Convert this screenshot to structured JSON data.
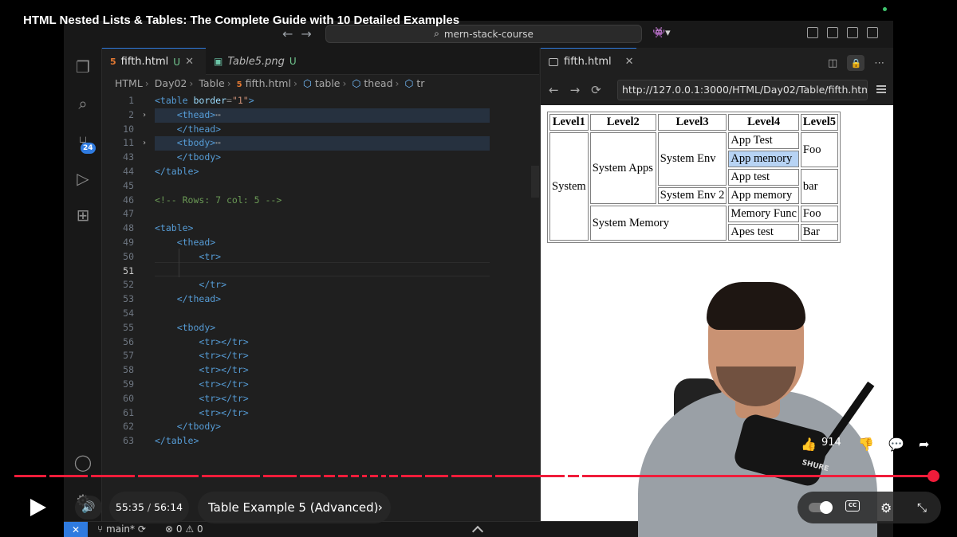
{
  "video": {
    "title": "HTML Nested Lists & Tables: The Complete Guide with 10 Detailed Examples",
    "time_current": "55:35",
    "time_total": "56:14",
    "chapter": "Table Example 5 (Advanced)",
    "likes": "914",
    "progress_fraction": 0.989
  },
  "vscode": {
    "command_center": "mern-stack-course",
    "scm_badge": "24",
    "tabs": [
      {
        "label": "fifth.html",
        "status": "U",
        "active": true
      },
      {
        "label": "Table5.png",
        "status": "U",
        "active": false
      }
    ],
    "breadcrumb": [
      "HTML",
      "Day02",
      "Table",
      "fifth.html",
      "table",
      "thead",
      "tr"
    ],
    "status": {
      "branch": "main*",
      "errors": "0",
      "warnings": "0"
    },
    "current_line": "51",
    "lines": [
      {
        "n": "1",
        "parts": [
          [
            "t",
            "<table "
          ],
          [
            "a",
            "border"
          ],
          [
            "p",
            "="
          ],
          [
            "s",
            "\"1\""
          ],
          [
            "t",
            ">"
          ]
        ]
      },
      {
        "n": "2",
        "fold": true,
        "hl": true,
        "parts": [
          [
            "p",
            "    "
          ],
          [
            "t",
            "<thead>"
          ],
          [
            "e",
            "⋯"
          ]
        ]
      },
      {
        "n": "10",
        "parts": [
          [
            "p",
            "    "
          ],
          [
            "t",
            "</thead>"
          ]
        ]
      },
      {
        "n": "11",
        "fold": true,
        "hl": true,
        "parts": [
          [
            "p",
            "    "
          ],
          [
            "t",
            "<tbody>"
          ],
          [
            "e",
            "⋯"
          ]
        ]
      },
      {
        "n": "43",
        "parts": [
          [
            "p",
            "    "
          ],
          [
            "t",
            "</tbody>"
          ]
        ]
      },
      {
        "n": "44",
        "parts": [
          [
            "t",
            "</table>"
          ]
        ]
      },
      {
        "n": "45",
        "parts": []
      },
      {
        "n": "46",
        "parts": [
          [
            "c",
            "<!-- Rows: 7 col: 5 -->"
          ]
        ]
      },
      {
        "n": "47",
        "parts": []
      },
      {
        "n": "48",
        "parts": [
          [
            "t",
            "<table>"
          ]
        ]
      },
      {
        "n": "49",
        "parts": [
          [
            "p",
            "    "
          ],
          [
            "t",
            "<thead>"
          ]
        ]
      },
      {
        "n": "50",
        "parts": [
          [
            "p",
            "        "
          ],
          [
            "t",
            "<tr>"
          ]
        ]
      },
      {
        "n": "51",
        "parts": []
      },
      {
        "n": "52",
        "parts": [
          [
            "p",
            "        "
          ],
          [
            "t",
            "</tr>"
          ]
        ]
      },
      {
        "n": "53",
        "parts": [
          [
            "p",
            "    "
          ],
          [
            "t",
            "</thead>"
          ]
        ]
      },
      {
        "n": "54",
        "parts": []
      },
      {
        "n": "55",
        "parts": [
          [
            "p",
            "    "
          ],
          [
            "t",
            "<tbody>"
          ]
        ]
      },
      {
        "n": "56",
        "parts": [
          [
            "p",
            "        "
          ],
          [
            "t",
            "<tr></tr>"
          ]
        ]
      },
      {
        "n": "57",
        "parts": [
          [
            "p",
            "        "
          ],
          [
            "t",
            "<tr></tr>"
          ]
        ]
      },
      {
        "n": "58",
        "parts": [
          [
            "p",
            "        "
          ],
          [
            "t",
            "<tr></tr>"
          ]
        ]
      },
      {
        "n": "59",
        "parts": [
          [
            "p",
            "        "
          ],
          [
            "t",
            "<tr></tr>"
          ]
        ]
      },
      {
        "n": "60",
        "parts": [
          [
            "p",
            "        "
          ],
          [
            "t",
            "<tr></tr>"
          ]
        ]
      },
      {
        "n": "61",
        "parts": [
          [
            "p",
            "        "
          ],
          [
            "t",
            "<tr></tr>"
          ]
        ]
      },
      {
        "n": "62",
        "parts": [
          [
            "p",
            "    "
          ],
          [
            "t",
            "</tbody>"
          ]
        ]
      },
      {
        "n": "63",
        "parts": [
          [
            "t",
            "</table>"
          ]
        ]
      }
    ]
  },
  "browser": {
    "tab_title": "fifth.html",
    "url": "http://127.0.0.1:3000/HTML/Day02/Table/fifth.html"
  },
  "rendered_table": {
    "headers": [
      "Level1",
      "Level2",
      "Level3",
      "Level4",
      "Level5"
    ],
    "system": "System",
    "system_apps": "System Apps",
    "system_env": "System Env",
    "system_env_2": "System Env 2",
    "system_memory": "System Memory",
    "app_test_1": "App Test",
    "app_memory_1": "App memory",
    "app_test_2": "App test",
    "app_memory_2": "App memory",
    "memory_func": "Memory Func",
    "apes_test": "Apes test",
    "foo_1": "Foo",
    "bar_1": "bar",
    "foo_2": "Foo",
    "bar_2": "Bar"
  },
  "icons": {
    "explorer": "files-icon",
    "search": "search-icon",
    "scm": "source-control-icon",
    "run": "run-debug-icon",
    "extensions": "extensions-icon",
    "account": "account-icon",
    "settings": "gear-icon"
  }
}
